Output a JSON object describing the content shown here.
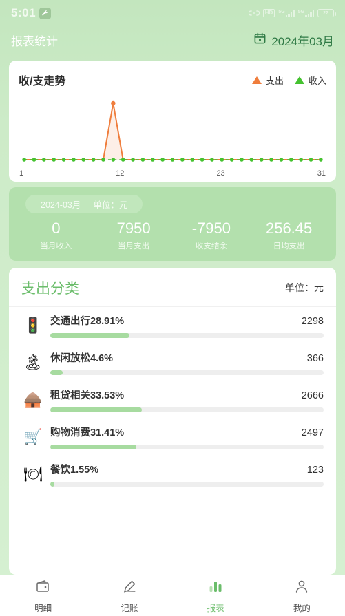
{
  "status_bar": {
    "time": "5:01",
    "badge_icon": "wrench-icon",
    "link_icon": "link-icon",
    "hd_label": "HD",
    "network_1": "5G",
    "network_2": "5G",
    "battery_label": "22"
  },
  "header": {
    "title": "报表统计",
    "calendar_icon": "calendar-icon",
    "month_value": "2024年03月"
  },
  "chart_card": {
    "title": "收/支走势",
    "legend": [
      {
        "label": "支出",
        "color": "#ef7d3c",
        "icon": "triangle-up-icon"
      },
      {
        "label": "收入",
        "color": "#45c230",
        "icon": "triangle-up-icon"
      }
    ]
  },
  "chart_data": {
    "type": "line",
    "title": "收/支走势",
    "xlabel": "",
    "ylabel": "",
    "grid": false,
    "legend_position": "top-right",
    "axis_tick_labels": [
      "1",
      "12",
      "23",
      "31"
    ],
    "x": [
      1,
      2,
      3,
      4,
      5,
      6,
      7,
      8,
      9,
      10,
      11,
      12,
      13,
      14,
      15,
      16,
      17,
      18,
      19,
      20,
      21,
      22,
      23,
      24,
      25,
      26,
      27,
      28,
      29,
      30,
      31
    ],
    "xlim": [
      1,
      31
    ],
    "ylim": [
      0,
      7950
    ],
    "series": [
      {
        "name": "支出",
        "color": "#ef7d3c",
        "values": [
          0,
          0,
          0,
          0,
          0,
          0,
          0,
          0,
          0,
          7950,
          0,
          0,
          0,
          0,
          0,
          0,
          0,
          0,
          0,
          0,
          0,
          0,
          0,
          0,
          0,
          0,
          0,
          0,
          0,
          0,
          0
        ]
      },
      {
        "name": "收入",
        "color": "#45c230",
        "values": [
          0,
          0,
          0,
          0,
          0,
          0,
          0,
          0,
          0,
          0,
          0,
          0,
          0,
          0,
          0,
          0,
          0,
          0,
          0,
          0,
          0,
          0,
          0,
          0,
          0,
          0,
          0,
          0,
          0,
          0,
          0
        ]
      }
    ]
  },
  "summary": {
    "period_label": "2024-03月",
    "unit_label": "单位：元",
    "cells": [
      {
        "value": "0",
        "label": "当月收入"
      },
      {
        "value": "7950",
        "label": "当月支出"
      },
      {
        "value": "-7950",
        "label": "收支结余"
      },
      {
        "value": "256.45",
        "label": "日均支出"
      }
    ]
  },
  "categories": {
    "title": "支出分类",
    "unit_label": "单位：元",
    "accent_color": "#a7dba0",
    "rows": [
      {
        "icon": "traffic-light-icon",
        "glyph": "🚦",
        "name": "交通出行28.91%",
        "percent": 28.91,
        "amount": "2298"
      },
      {
        "icon": "palm-beach-icon",
        "glyph": "🏝",
        "name": "休闲放松4.6%",
        "percent": 4.6,
        "amount": "366"
      },
      {
        "icon": "hut-house-icon",
        "glyph": "🛖",
        "name": "租贷相关33.53%",
        "percent": 33.53,
        "amount": "2666"
      },
      {
        "icon": "shopping-cart-icon",
        "glyph": "🛒",
        "name": "购物消费31.41%",
        "percent": 31.41,
        "amount": "2497"
      },
      {
        "icon": "food-cloche-icon",
        "glyph": "🍽",
        "name": "餐饮1.55%",
        "percent": 1.55,
        "amount": "123"
      }
    ]
  },
  "tabbar": {
    "active_index": 2,
    "active_color": "#6bbd6b",
    "items": [
      {
        "icon": "wallet-icon",
        "label": "明细"
      },
      {
        "icon": "pen-icon",
        "label": "记账"
      },
      {
        "icon": "bar-chart-icon",
        "label": "报表"
      },
      {
        "icon": "person-icon",
        "label": "我的"
      }
    ]
  }
}
